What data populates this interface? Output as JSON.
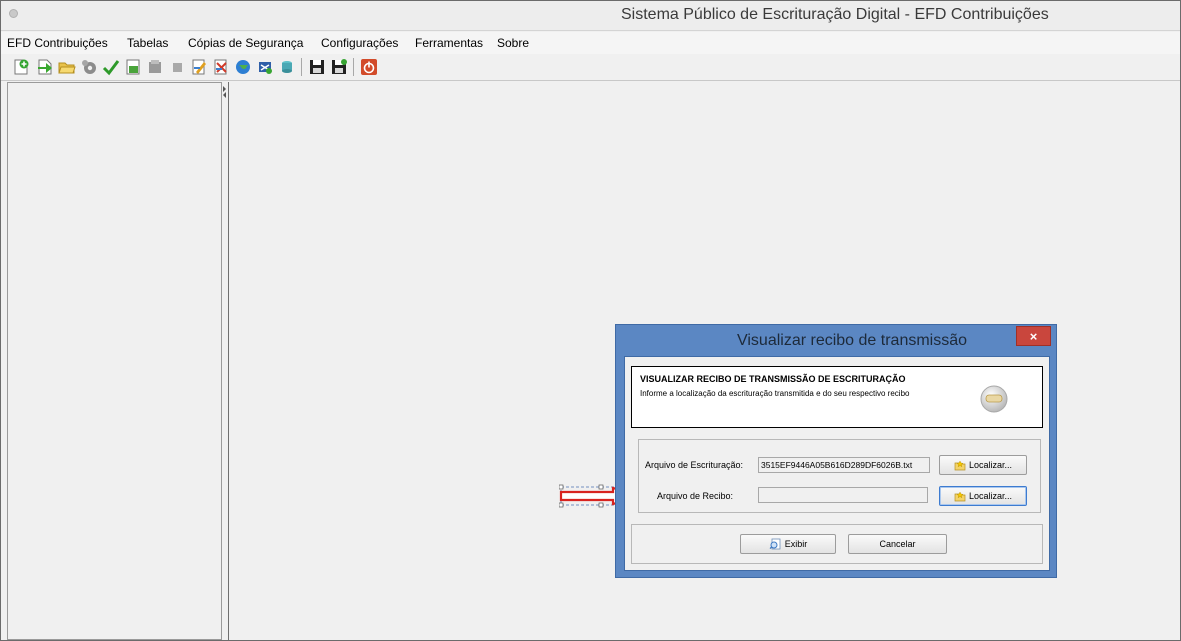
{
  "window": {
    "title": "Sistema Público de Escrituração Digital - EFD Contribuições"
  },
  "menu": [
    {
      "label": "EFD Contribuições",
      "name": "menu-efd-contribuicoes"
    },
    {
      "label": "Tabelas",
      "name": "menu-tabelas"
    },
    {
      "label": "Cópias de Segurança",
      "name": "menu-copias-de-seguranca"
    },
    {
      "label": "Configurações",
      "name": "menu-configuracoes"
    },
    {
      "label": "Ferramentas",
      "name": "menu-ferramentas"
    },
    {
      "label": "Sobre",
      "name": "menu-sobre"
    }
  ],
  "toolbar": {
    "icons": [
      "new-document-icon",
      "import-arrow-icon",
      "open-folder-icon",
      "gear-icon",
      "validate-check-icon",
      "print-icon",
      "sign-icon",
      "stop-icon",
      "edit-document-icon",
      "delete-document-icon",
      "globe-icon",
      "receipt-icon",
      "query-icon",
      "save-icon",
      "save-as-icon",
      "exit-icon"
    ]
  },
  "dialog": {
    "title": "Visualizar recibo de transmissão",
    "close_label": "×",
    "header_title": "VISUALIZAR RECIBO DE TRANSMISSÃO DE ESCRITURAÇÃO",
    "header_subtitle": "Informe a localização da escrituração transmitida e do seu respectivo recibo",
    "escrituracao_label": "Arquivo de Escrituração:",
    "escrituracao_value": "3515EF9446A05B616D289DF6026B.txt",
    "recibo_label": "Arquivo de Recibo:",
    "recibo_value": "",
    "localizar_label": "Localizar...",
    "exibir_label": "Exibir",
    "cancelar_label": "Cancelar"
  },
  "colors": {
    "dialog_frame": "#5b87c3",
    "close_button": "#c9463d",
    "annotation_arrow": "#d8231f",
    "toolbar_green": "#2e9a2a",
    "exit_red": "#d24b2a"
  }
}
